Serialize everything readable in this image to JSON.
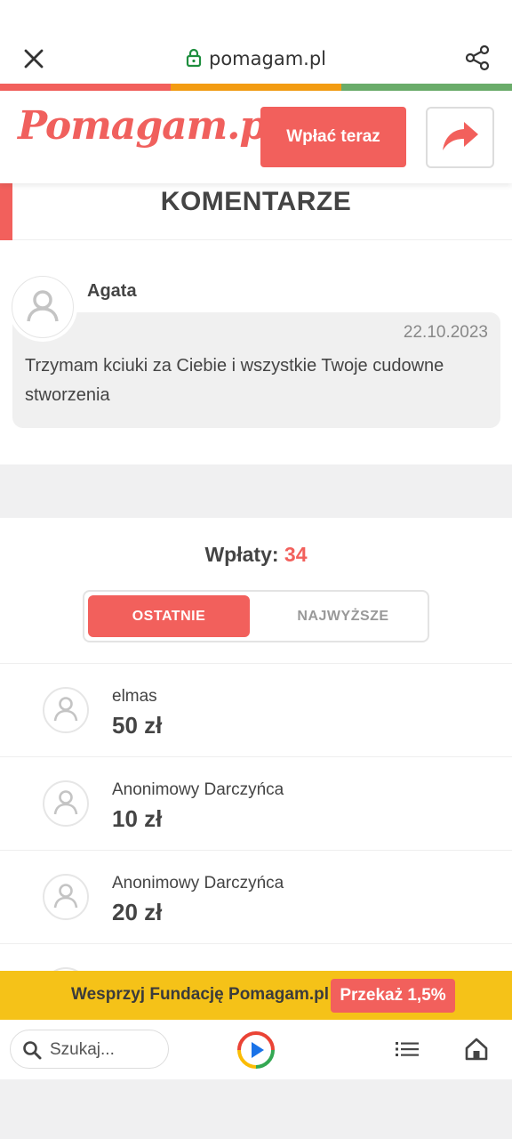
{
  "browser": {
    "url": "pomagam.pl"
  },
  "colors": {
    "stripe": [
      "#f2605c",
      "#f39c12",
      "#6aac6a"
    ],
    "accent": "#f2605c",
    "banner": "#f5c218"
  },
  "header": {
    "logo": "Pomagam.pl",
    "donate_label": "Wpłać teraz"
  },
  "comments": {
    "heading": "KOMENTARZE",
    "items": [
      {
        "author": "Agata",
        "date": "22.10.2023",
        "text": "Trzymam kciuki za Ciebie i wszystkie Twoje cudowne stworzenia"
      }
    ]
  },
  "donations": {
    "title_label": "Wpłaty:",
    "count": "34",
    "tabs": [
      "OSTATNIE",
      "NAJWYŻSZE"
    ],
    "active_tab": "OSTATNIE",
    "items": [
      {
        "name": "elmas",
        "amount": "50 zł"
      },
      {
        "name": "Anonimowy Darczyńca",
        "amount": "10 zł"
      },
      {
        "name": "Anonimowy Darczyńca",
        "amount": "20 zł"
      }
    ]
  },
  "banner": {
    "text": "Wesprzyj Fundację Pomagam.pl",
    "cta": "Przekaż 1,5%"
  },
  "bottom_bar": {
    "search_placeholder": "Szukaj..."
  }
}
